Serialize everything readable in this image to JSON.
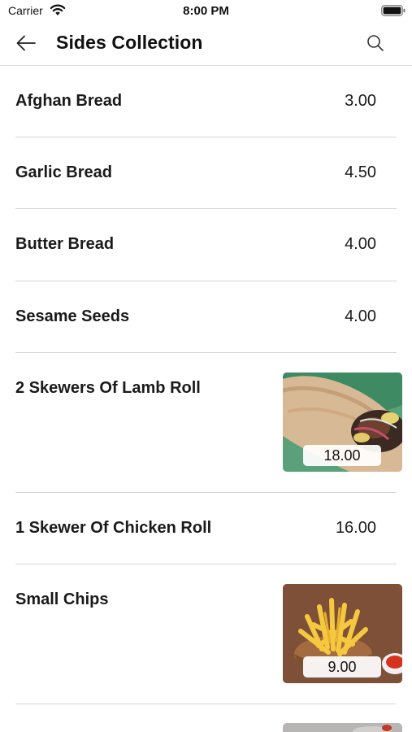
{
  "status_bar": {
    "carrier": "Carrier",
    "time": "8:00 PM",
    "icons": [
      "wifi-icon",
      "battery-icon"
    ]
  },
  "nav": {
    "title": "Sides Collection",
    "back_icon": "back-arrow-icon",
    "search_icon": "search-icon"
  },
  "items": [
    {
      "name": "Afghan Bread",
      "price": "3.00"
    },
    {
      "name": "Garlic Bread",
      "price": "4.50"
    },
    {
      "name": "Butter Bread",
      "price": "4.00"
    },
    {
      "name": "Sesame Seeds",
      "price": "4.00"
    },
    {
      "name": "2 Skewers Of Lamb Roll",
      "price": "18.00",
      "image": "lamb-roll-photo"
    },
    {
      "name": "1 Skewer Of Chicken Roll",
      "price": "16.00"
    },
    {
      "name": "Small Chips",
      "price": "9.00",
      "image": "chips-photo"
    }
  ]
}
